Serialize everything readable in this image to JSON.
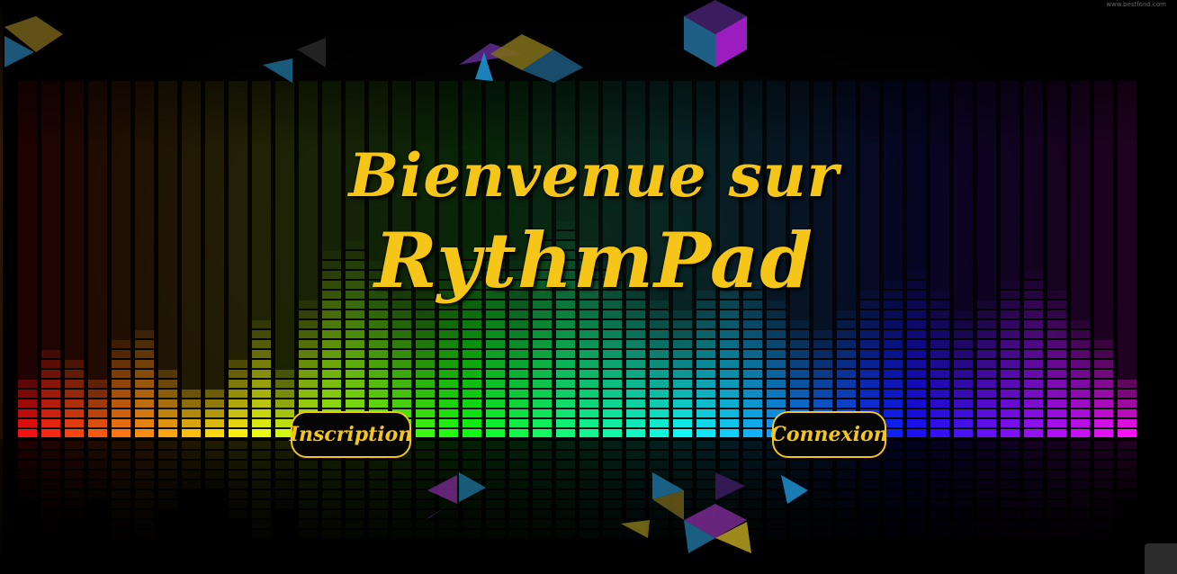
{
  "hero": {
    "title_line1": "Bienvenue sur",
    "title_line2": "RythmPad"
  },
  "buttons": {
    "signup_label": "Inscription",
    "login_label": "Connexion"
  },
  "watermark": {
    "text": "www.bestfond.com"
  },
  "colors": {
    "accent": "#f5c518",
    "background": "#000000",
    "button_background": "#050505"
  }
}
